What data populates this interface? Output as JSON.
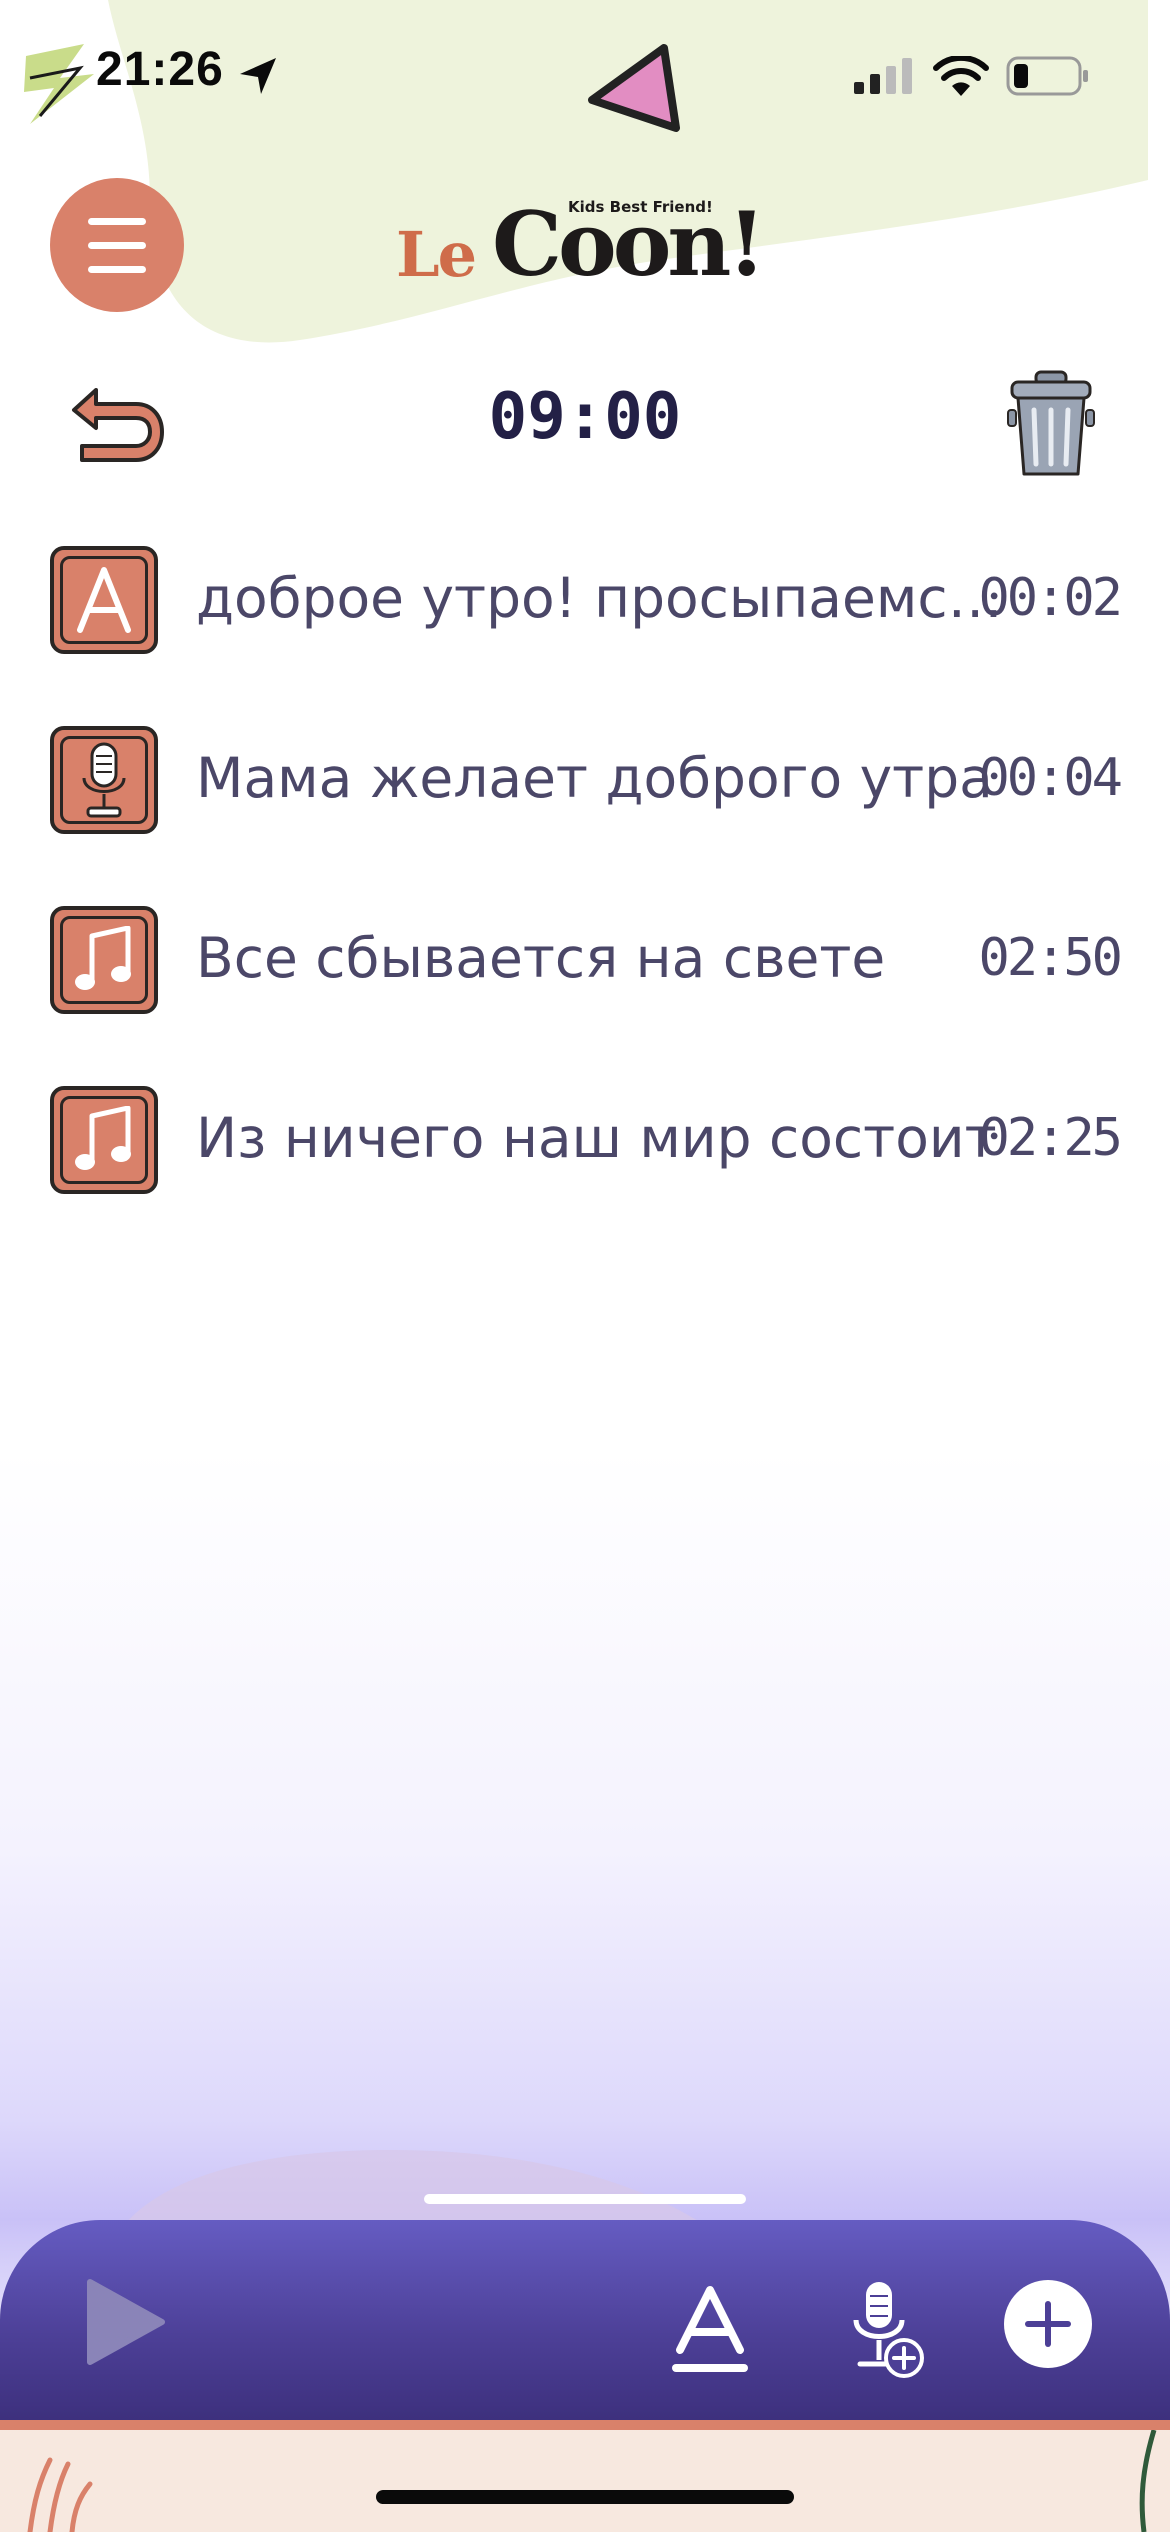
{
  "status_bar": {
    "time": "21:26",
    "icons": [
      "location-arrow-icon",
      "cellular-signal-icon",
      "wifi-icon",
      "battery-icon"
    ]
  },
  "header": {
    "brand_le": "Le",
    "brand_coon": "Coon!",
    "brand_tagline": "Kids Best Friend!",
    "menu_icon": "hamburger-menu-icon",
    "decoration_icon": "triangle-icon"
  },
  "toolbar": {
    "alarm_time": "09:00",
    "back_icon": "back-arrow-icon",
    "delete_icon": "trash-can-icon"
  },
  "items": [
    {
      "type": "text",
      "icon": "letter-a-icon",
      "title": "доброе утро! просыпаемся, солнышко",
      "duration": "00:02"
    },
    {
      "type": "voice",
      "icon": "microphone-icon",
      "title": "Мама желает доброго утра",
      "duration": "00:04"
    },
    {
      "type": "music",
      "icon": "music-note-icon",
      "title": "Все сбывается на свете",
      "duration": "02:50"
    },
    {
      "type": "music",
      "icon": "music-note-icon",
      "title": "Из ничего наш мир состоит",
      "duration": "02:25"
    }
  ],
  "player_bar": {
    "icons": [
      "play-icon",
      "add-text-icon",
      "add-voice-icon",
      "plus-icon"
    ]
  },
  "colors": {
    "accent": "#d9816a",
    "text": "#4b4768",
    "dark_text": "#232046",
    "bar_purple": "#5148a6",
    "blob_green": "#eef3dc"
  }
}
